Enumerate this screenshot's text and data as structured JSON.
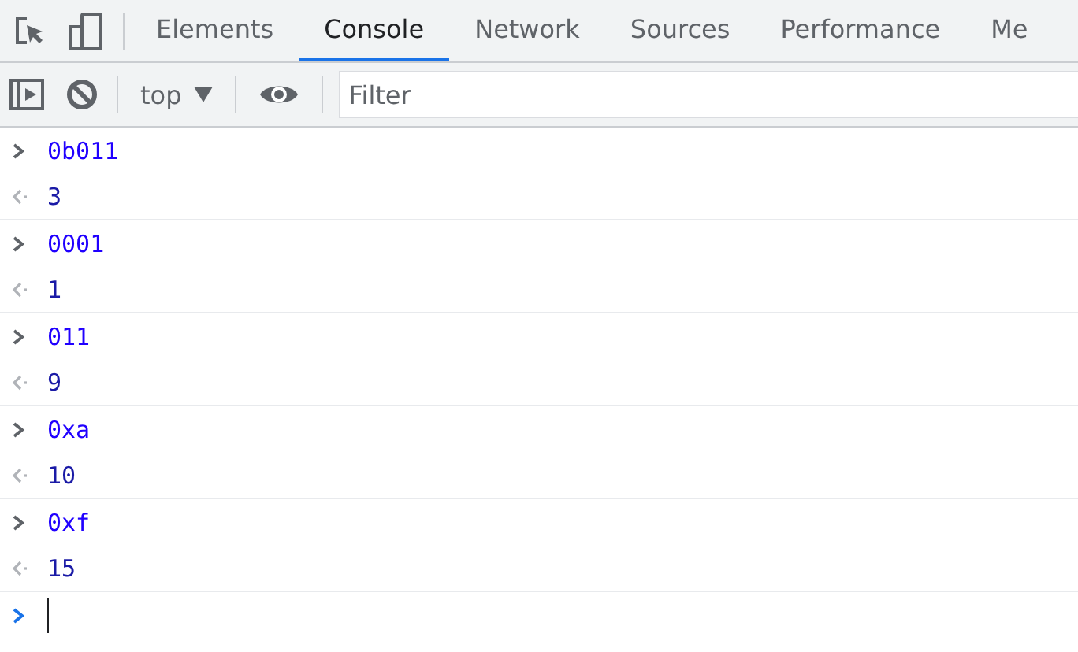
{
  "tabs": [
    {
      "label": "Elements",
      "selected": false
    },
    {
      "label": "Console",
      "selected": true
    },
    {
      "label": "Network",
      "selected": false
    },
    {
      "label": "Sources",
      "selected": false
    },
    {
      "label": "Performance",
      "selected": false
    },
    {
      "label": "Me",
      "selected": false
    }
  ],
  "toolbar": {
    "context": "top",
    "filter": {
      "placeholder": "Filter"
    }
  },
  "entries": [
    {
      "input": "0b011",
      "result": "3"
    },
    {
      "input": "0001",
      "result": "1"
    },
    {
      "input": "011",
      "result": "9"
    },
    {
      "input": "0xa",
      "result": "10"
    },
    {
      "input": "0xf",
      "result": "15"
    }
  ]
}
